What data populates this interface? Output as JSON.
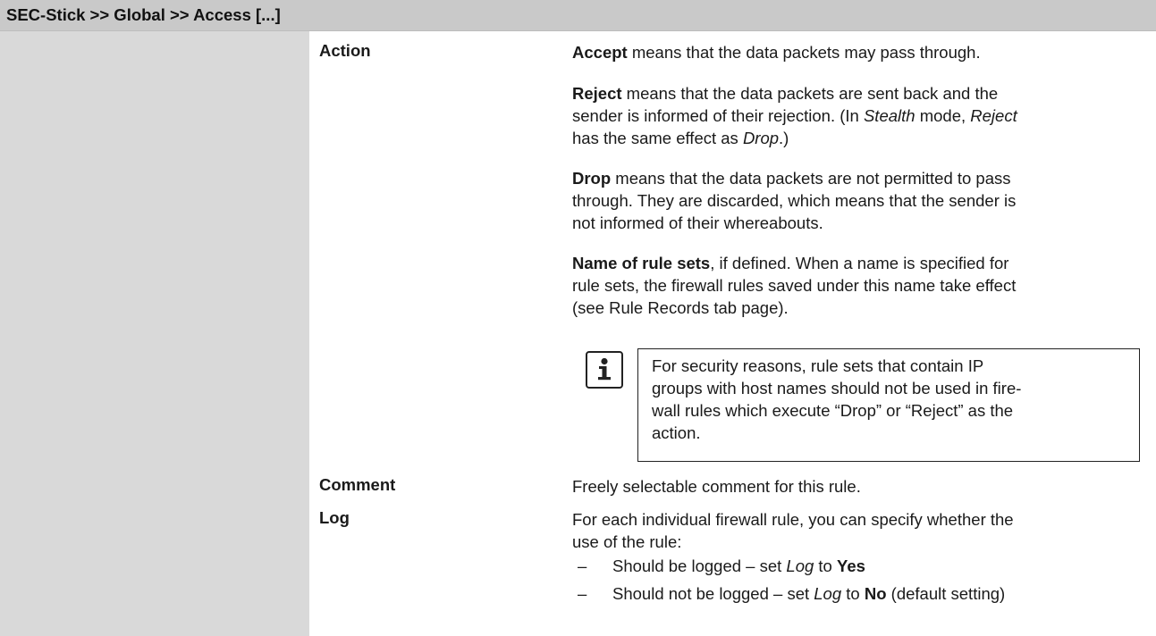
{
  "header": {
    "title": "SEC-Stick >> Global >> Access [...]"
  },
  "rows": {
    "action": {
      "label": "Action",
      "accept": {
        "term": "Accept",
        "text": " means that the data packets may pass through."
      },
      "reject": {
        "term": "Reject",
        "line1_rest": " means that the data packets are sent back and the",
        "line2_a": "sender is informed of their rejection. (In ",
        "line2_stealth": "Stealth",
        "line2_b": " mode, ",
        "line2_reject": "Reject",
        "line3_has": "has the same effect as ",
        "line3_drop": "Drop",
        "line3_end": ".)"
      },
      "drop": {
        "term": "Drop",
        "line1_rest": " means that the data packets are not permitted to pass",
        "line2": "through. They are discarded, which means that the sender is",
        "line3": "not informed of their whereabouts."
      },
      "rulesets": {
        "term": "Name of rule sets",
        "line1_rest": ", if defined. When a name is specified for",
        "line2": "rule sets, the firewall rules saved under this name take effect",
        "line3": "(see Rule Records tab page)."
      },
      "note": {
        "icon": "info-icon",
        "lines": [
          "For security reasons, rule sets that contain IP",
          "groups with host names should not be used in fire-",
          "wall rules which execute “Drop” or “Reject” as the",
          "action."
        ]
      }
    },
    "comment": {
      "label": "Comment",
      "text": "Freely selectable comment for this rule."
    },
    "log": {
      "label": "Log",
      "line1": "For each individual firewall rule, you can specify whether the",
      "line2": "use of the rule:",
      "bullets": [
        {
          "dash": "–",
          "text_a": "Should be logged – set ",
          "italic": "Log",
          "text_b": " to ",
          "bold": "Yes",
          "text_c": ""
        },
        {
          "dash": "–",
          "text_a": "Should not be logged – set ",
          "italic": "Log",
          "text_b": " to ",
          "bold": "No",
          "text_c": " (default setting)"
        }
      ]
    }
  }
}
